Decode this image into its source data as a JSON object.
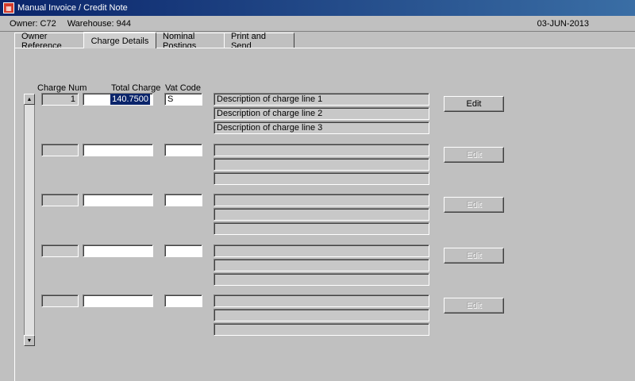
{
  "window": {
    "title": "Manual Invoice / Credit Note",
    "icon": "app-form-icon"
  },
  "info": {
    "owner": "Owner:  C72",
    "warehouse": "Warehouse:  944",
    "date": "03-JUN-2013"
  },
  "tabs": [
    {
      "label": "Owner Reference"
    },
    {
      "label": "Charge Details"
    },
    {
      "label": "Nominal Postings"
    },
    {
      "label": "Print and Send"
    }
  ],
  "columns": {
    "charge_num": "Charge Num",
    "total_charge": "Total Charge",
    "vat_code": "Vat Code"
  },
  "rows": [
    {
      "charge_num": "1",
      "total_charge": "140.7500",
      "vat_code": "S",
      "descriptions": [
        "Description of charge line 1",
        "Description of charge line 2",
        "Description of charge line 3"
      ],
      "edit_label": "Edit"
    },
    {
      "charge_num": "",
      "total_charge": "",
      "vat_code": "",
      "descriptions": [
        "",
        "",
        ""
      ],
      "edit_label": "Edit"
    },
    {
      "charge_num": "",
      "total_charge": "",
      "vat_code": "",
      "descriptions": [
        "",
        "",
        ""
      ],
      "edit_label": "Edit"
    },
    {
      "charge_num": "",
      "total_charge": "",
      "vat_code": "",
      "descriptions": [
        "",
        "",
        ""
      ],
      "edit_label": "Edit"
    },
    {
      "charge_num": "",
      "total_charge": "",
      "vat_code": "",
      "descriptions": [
        "",
        "",
        ""
      ],
      "edit_label": "Edit"
    }
  ],
  "scrollbar": {
    "up": "▲",
    "down": "▼"
  }
}
